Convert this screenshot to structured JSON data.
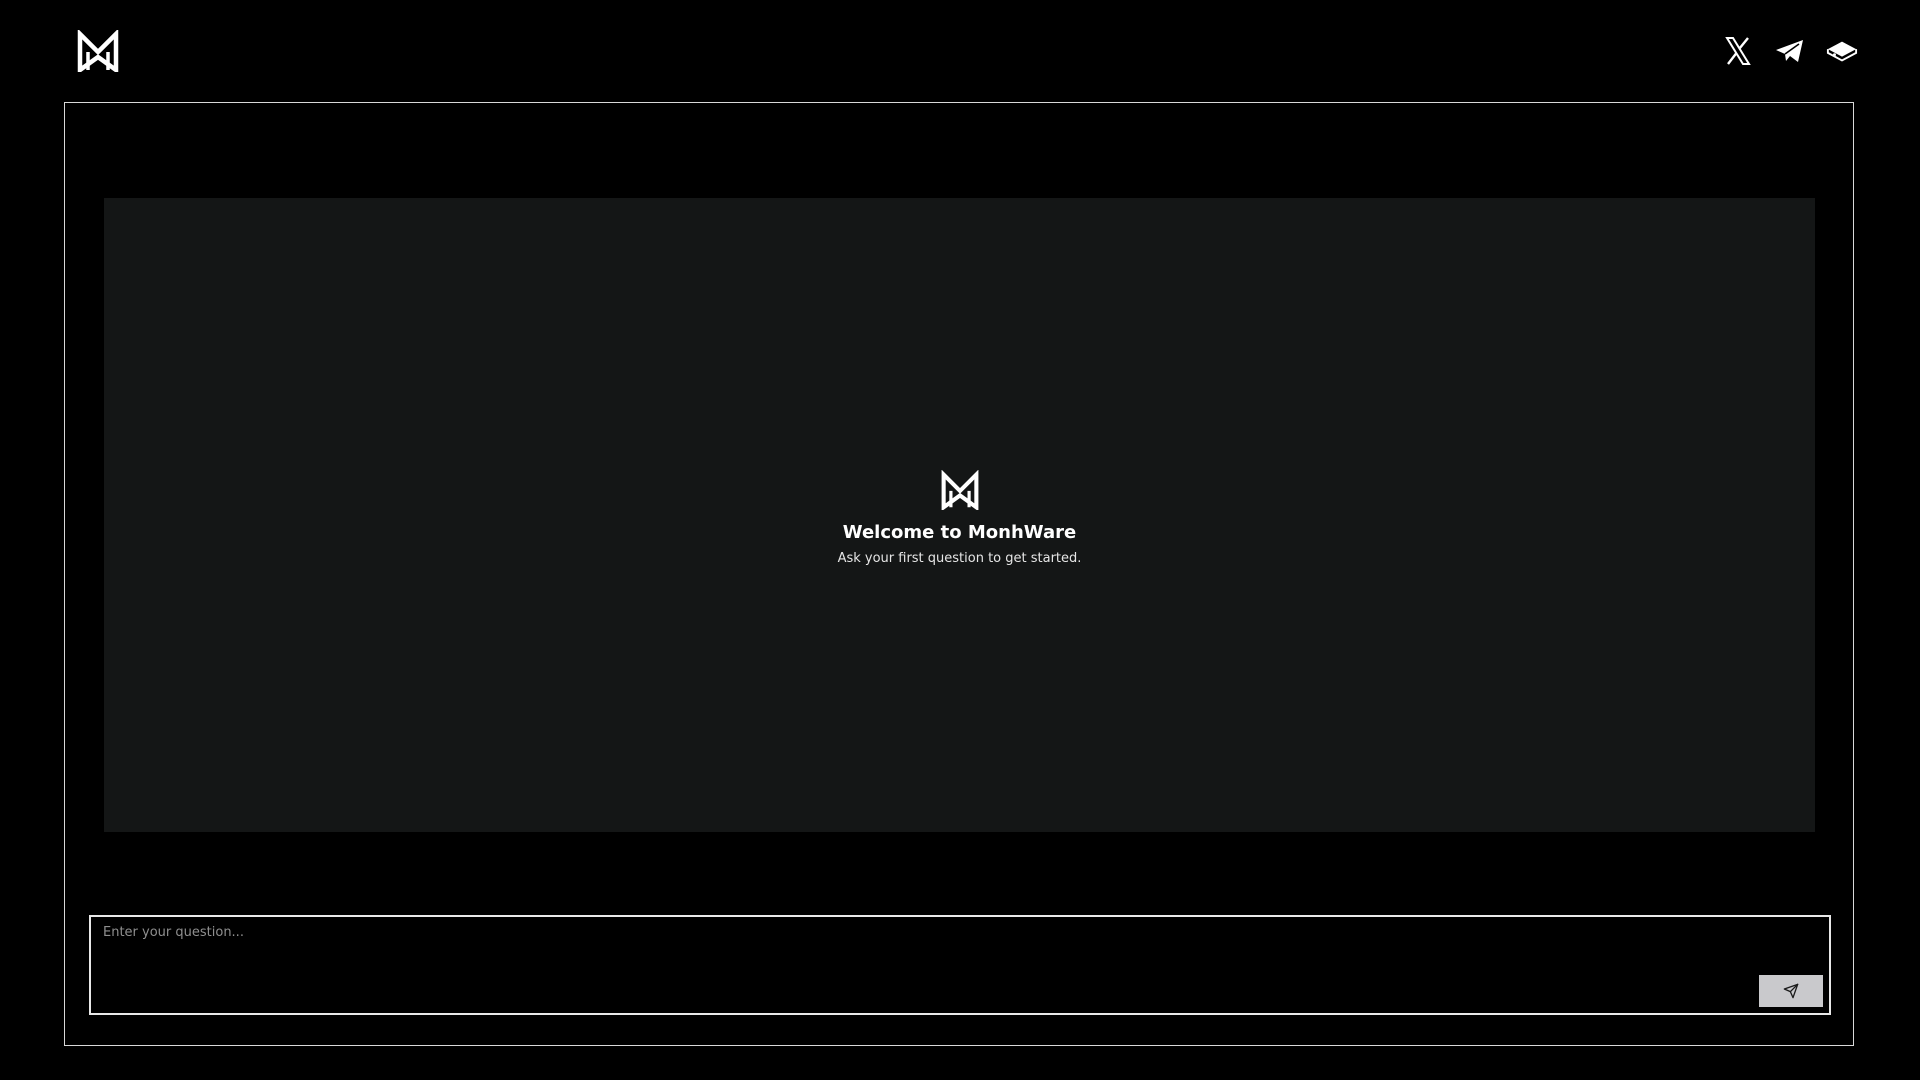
{
  "header": {
    "logo_icon": "monhware-logo-icon",
    "social_links": [
      {
        "name": "x",
        "icon": "x-icon"
      },
      {
        "name": "telegram",
        "icon": "telegram-icon"
      },
      {
        "name": "gitbook",
        "icon": "gitbook-icon"
      }
    ]
  },
  "chat": {
    "logo_icon": "monhware-logo-icon",
    "welcome_title": "Welcome to MonhWare",
    "welcome_subtitle": "Ask your first question to get started."
  },
  "composer": {
    "placeholder": "Enter your question...",
    "value": "",
    "send_icon": "send-icon"
  },
  "colors": {
    "background": "#000000",
    "chat_panel": "#141616",
    "frame_border": "#d9d9d9",
    "send_button": "#c9c9cc",
    "placeholder": "#8f8f8f"
  }
}
